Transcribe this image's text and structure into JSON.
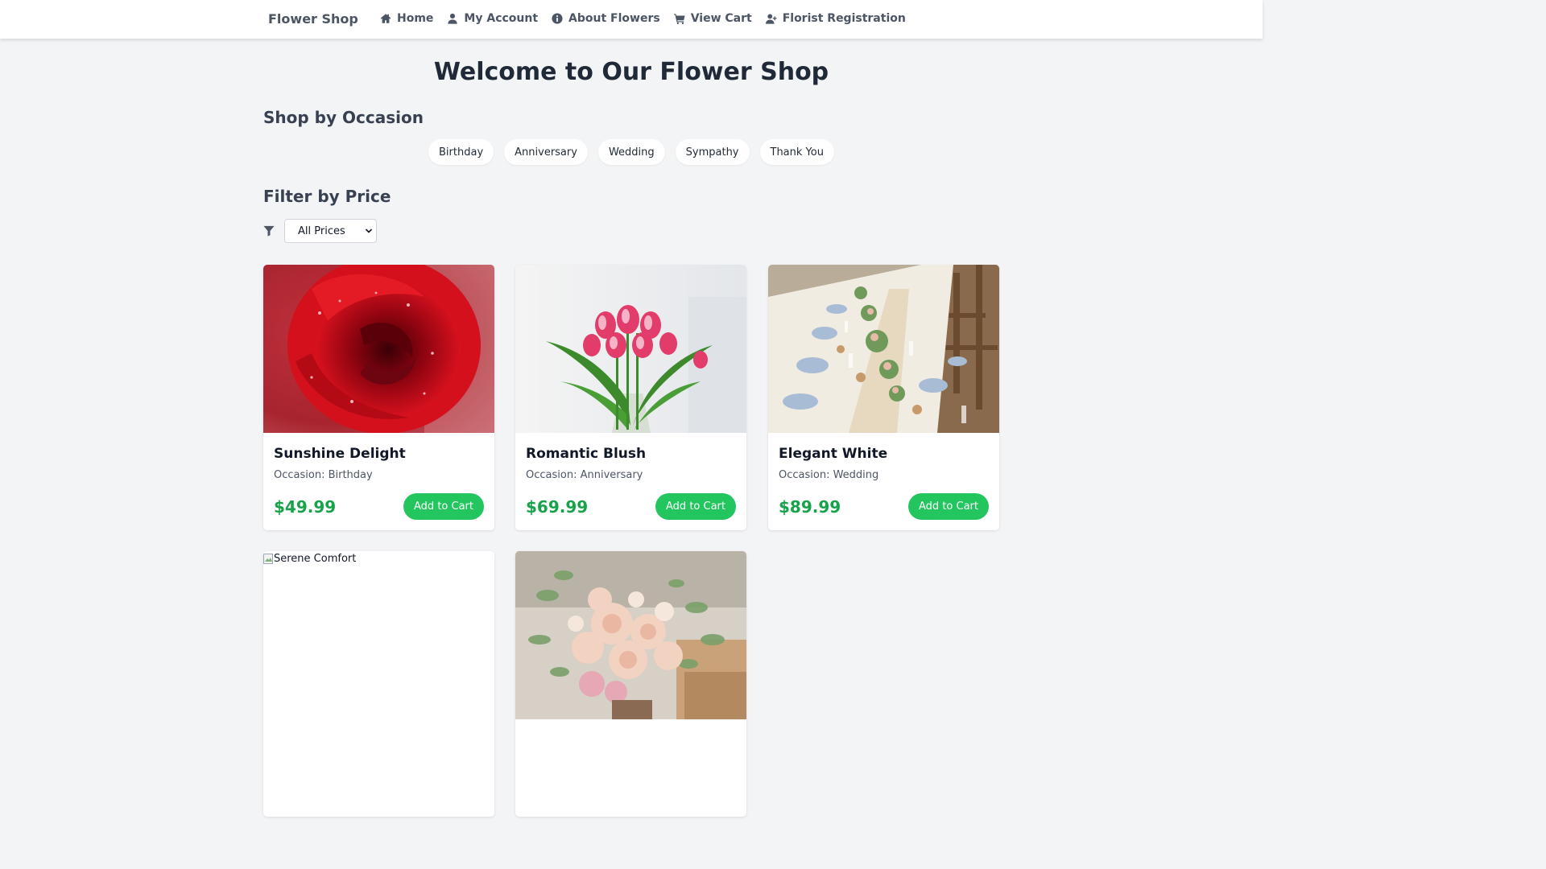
{
  "nav": {
    "brand": "Flower Shop",
    "links": [
      {
        "label": "Home",
        "icon": "home-icon"
      },
      {
        "label": "My Account",
        "icon": "user-icon"
      },
      {
        "label": "About Flowers",
        "icon": "info-icon"
      },
      {
        "label": "View Cart",
        "icon": "cart-icon"
      },
      {
        "label": "Florist Registration",
        "icon": "user-plus-icon"
      }
    ]
  },
  "page": {
    "title": "Welcome to Our Flower Shop"
  },
  "occasions": {
    "title": "Shop by Occasion",
    "items": [
      "Birthday",
      "Anniversary",
      "Wedding",
      "Sympathy",
      "Thank You"
    ]
  },
  "filter": {
    "title": "Filter by Price",
    "icon": "filter-icon",
    "selected": "All Prices"
  },
  "products": [
    {
      "name": "Sunshine Delight",
      "occasion": "Occasion: Birthday",
      "price": "$49.99",
      "button": "Add to Cart",
      "image": "red-rose-photo"
    },
    {
      "name": "Romantic Blush",
      "occasion": "Occasion: Anniversary",
      "price": "$69.99",
      "button": "Add to Cart",
      "image": "pink-tulips-photo"
    },
    {
      "name": "Elegant White",
      "occasion": "Occasion: Wedding",
      "price": "$89.99",
      "button": "Add to Cart",
      "image": "wedding-table-photo"
    },
    {
      "image_alt": "Serene Comfort",
      "image": "broken-image"
    },
    {
      "image": "peach-bouquet-photo"
    }
  ],
  "colors": {
    "accent": "#22c55e",
    "price": "#16a34a",
    "background": "#f3f4f6",
    "nav_text": "#4b5563"
  }
}
